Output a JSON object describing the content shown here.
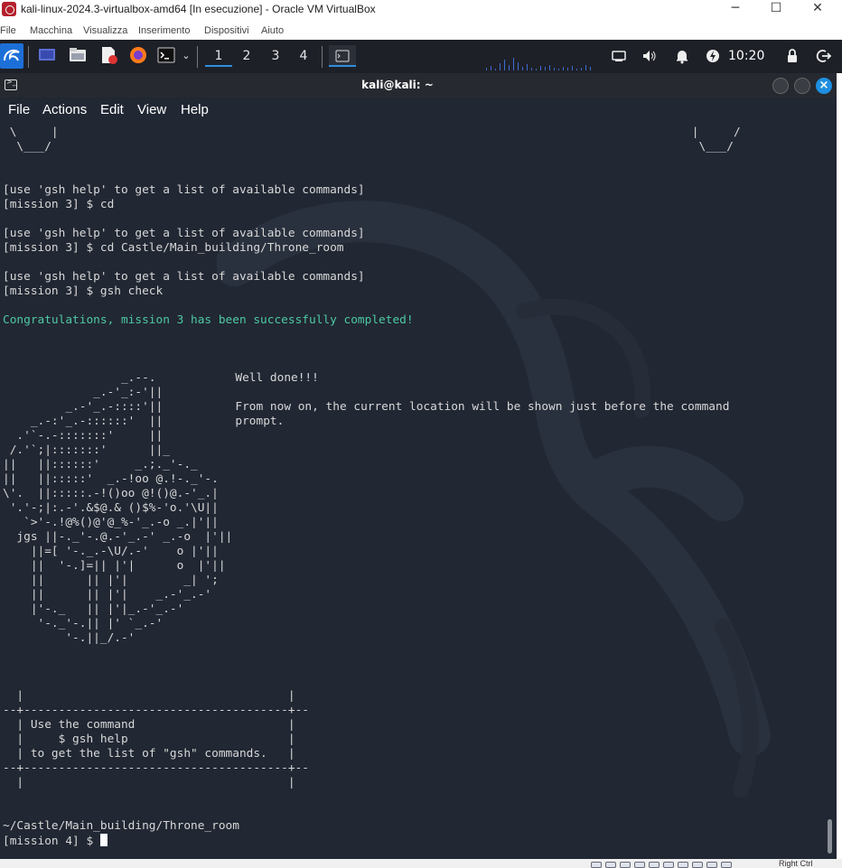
{
  "window": {
    "title": "kali-linux-2024.3-virtualbox-amd64 [In esecuzione] - Oracle VM VirtualBox",
    "minimize_glyph": "─",
    "maximize_glyph": "☐",
    "close_glyph": "✕"
  },
  "vbox_menu": [
    "File",
    "Macchina",
    "Visualizza",
    "Inserimento",
    "Dispositivi",
    "Aiuto"
  ],
  "panel": {
    "workspaces": [
      "1",
      "2",
      "3",
      "4"
    ],
    "active_workspace": "1",
    "launcher_icons": [
      "kali-menu-icon",
      "desktop-icon",
      "file-manager-icon",
      "text-editor-icon",
      "firefox-icon",
      "terminal-icon",
      "launcher-dropdown-icon"
    ],
    "tray_icons": [
      "network-icon",
      "volume-icon",
      "notifications-icon",
      "power-icon",
      "lock-icon",
      "logout-icon"
    ],
    "clock": "10:20",
    "colors": {
      "background": "#1e2028",
      "active_workspace": "#2f8fdd"
    }
  },
  "terminal": {
    "title": "kali@kali: ~",
    "menu": [
      "File",
      "Actions",
      "Edit",
      "View",
      "Help"
    ],
    "colors": {
      "background": "#212733",
      "text": "#d8d8d8",
      "success": "#4ec9a3",
      "close_button": "#1e8fe0"
    },
    "lines": [
      {
        "row": 0,
        "col": 0,
        "text": " \\     |                                                                                           |     /"
      },
      {
        "row": 1,
        "col": 0,
        "text": "  \\___/                                                                                             \\___/"
      },
      {
        "row": 4,
        "col": 0,
        "text": "[use 'gsh help' to get a list of available commands]"
      },
      {
        "row": 5,
        "col": 0,
        "text": "[mission 3] $ cd"
      },
      {
        "row": 7,
        "col": 0,
        "text": "[use 'gsh help' to get a list of available commands]"
      },
      {
        "row": 8,
        "col": 0,
        "text": "[mission 3] $ cd Castle/Main_building/Throne_room"
      },
      {
        "row": 10,
        "col": 0,
        "text": "[use 'gsh help' to get a list of available commands]"
      },
      {
        "row": 11,
        "col": 0,
        "text": "[mission 3] $ gsh check"
      },
      {
        "row": 13,
        "col": 0,
        "text": "Congratulations, mission 3 has been successfully completed!",
        "style": "success"
      },
      {
        "row": 17,
        "col": 33,
        "text": "Well done!!!"
      },
      {
        "row": 19,
        "col": 33,
        "text": "From now on, the current location will be shown just before the command"
      },
      {
        "row": 20,
        "col": 33,
        "text": "prompt."
      },
      {
        "row": 17,
        "col": 0,
        "text": "                 _.--."
      },
      {
        "row": 18,
        "col": 0,
        "text": "             _.-'_:-'||"
      },
      {
        "row": 19,
        "col": 0,
        "text": "         _.-'_.-::::'||"
      },
      {
        "row": 20,
        "col": 0,
        "text": "    _.-:'_.-::::::'  ||"
      },
      {
        "row": 21,
        "col": 0,
        "text": "  .'`-.-:::::::'     ||"
      },
      {
        "row": 22,
        "col": 0,
        "text": " /.'`;|:::::::'      ||_"
      },
      {
        "row": 23,
        "col": 0,
        "text": "||   ||::::::'     _.;._'-._"
      },
      {
        "row": 24,
        "col": 0,
        "text": "||   ||:::::'  _.-!oo @.!-._'-."
      },
      {
        "row": 25,
        "col": 0,
        "text": "\\'.  ||:::::.-!()oo @!()@.-'_.|"
      },
      {
        "row": 26,
        "col": 0,
        "text": " '.'-;|:.-'.&$@.& ()$%-'o.'\\U||"
      },
      {
        "row": 27,
        "col": 0,
        "text": "   `>'-.!@%()@'@_%-'_.-o _.|'||"
      },
      {
        "row": 28,
        "col": 0,
        "text": "  jgs ||-._'-.@.-'_.-' _.-o  |'||"
      },
      {
        "row": 29,
        "col": 0,
        "text": "    ||=[ '-._.-\\U/.-'    o |'||"
      },
      {
        "row": 30,
        "col": 0,
        "text": "    ||  '-.]=|| |'|      o  |'||"
      },
      {
        "row": 31,
        "col": 0,
        "text": "    ||      || |'|        _| ';"
      },
      {
        "row": 32,
        "col": 0,
        "text": "    ||      || |'|    _.-'_.-'"
      },
      {
        "row": 33,
        "col": 0,
        "text": "    |'-._   || |'|_.-'_.-'"
      },
      {
        "row": 34,
        "col": 0,
        "text": "     '-._'-.|| |' `_.-'"
      },
      {
        "row": 35,
        "col": 0,
        "text": "         '-.||_/.-'"
      },
      {
        "row": 39,
        "col": 0,
        "text": "  |                                      |"
      },
      {
        "row": 40,
        "col": 0,
        "text": "--+--------------------------------------+--"
      },
      {
        "row": 41,
        "col": 0,
        "text": "  | Use the command                      |"
      },
      {
        "row": 42,
        "col": 0,
        "text": "  |     $ gsh help                       |"
      },
      {
        "row": 43,
        "col": 0,
        "text": "  | to get the list of \"gsh\" commands.   |"
      },
      {
        "row": 44,
        "col": 0,
        "text": "--+--------------------------------------+--"
      },
      {
        "row": 45,
        "col": 0,
        "text": "  |                                      |"
      },
      {
        "row": 48,
        "col": 0,
        "text": "~/Castle/Main_building/Throne_room"
      }
    ],
    "prompt": "[mission 4] $ "
  },
  "status_bar": {
    "host_key": "Right Ctrl"
  }
}
